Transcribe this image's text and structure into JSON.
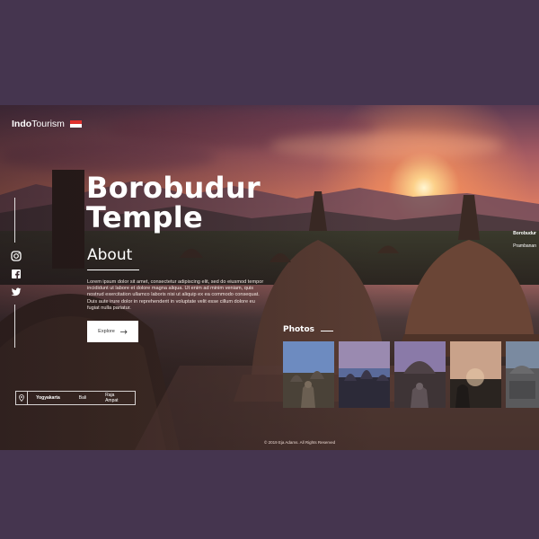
{
  "brand": {
    "name_bold": "Indo",
    "name_regular": "Tourism"
  },
  "hero": {
    "title_line1": "Borobudur",
    "title_line2": "Temple",
    "about_heading": "About",
    "description": "Lorem ipsum dolor sit amet, consectetur adipiscing elit, sed do eiusmod tempor incididunt ut labore et dolore magna aliqua. Ut enim ad minim veniam, quis nostrud exercitation ullamco laboris nisi ut aliquip ex ea commodo consequat. Duis aute irure dolor in reprehenderit in voluptate velit esse cillum dolore eu fugiat nulla pariatur.",
    "explore_label": "Explore"
  },
  "social": [
    "instagram-icon",
    "facebook-icon",
    "twitter-icon"
  ],
  "locations": {
    "items": [
      "Yogyakarta",
      "Bali",
      "Raja Ampat"
    ],
    "active": "Yogyakarta"
  },
  "photos": {
    "heading": "Photos"
  },
  "side_nav": {
    "current": "Borobudur",
    "next": "Prambanan"
  },
  "footer": {
    "copyright": "© 2019 Eja Adams. All Rights Reserved"
  },
  "colors": {
    "page_bg": "#45354f",
    "sun": "#fff6d2",
    "sky_warm": "#de7d62",
    "flag_red": "#e0322f"
  }
}
